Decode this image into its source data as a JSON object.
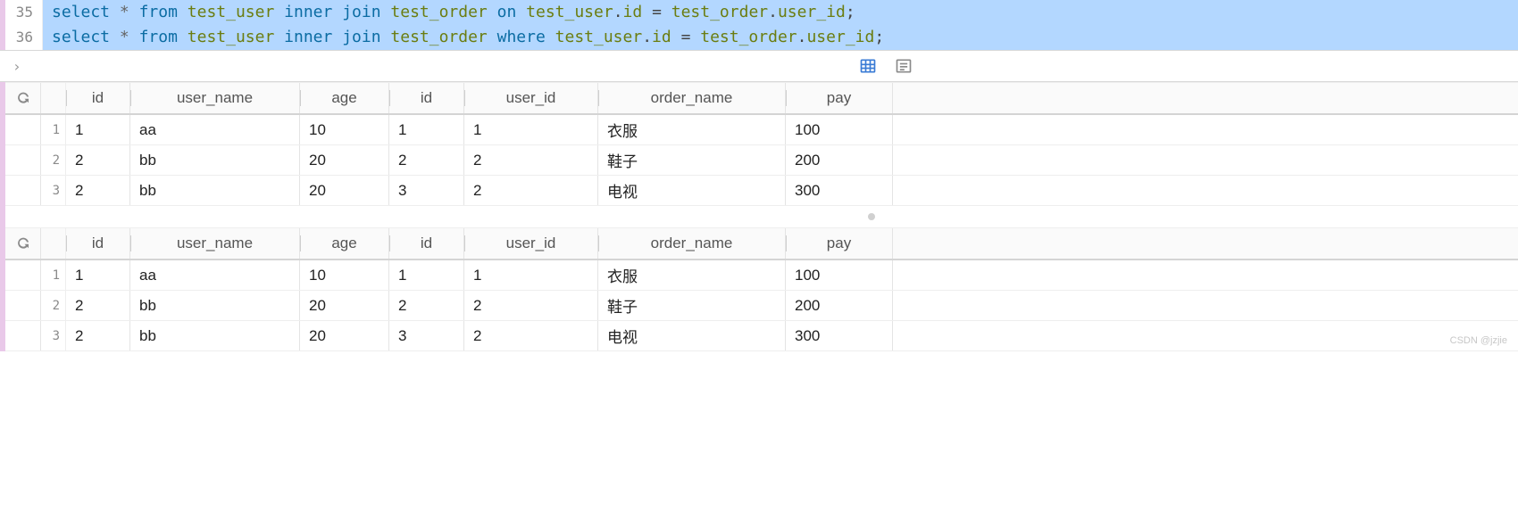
{
  "editor": {
    "lines": [
      {
        "num": "35",
        "selected": true,
        "tokens": [
          {
            "cls": "kw",
            "t": "select"
          },
          {
            "cls": "",
            "t": " "
          },
          {
            "cls": "star",
            "t": "*"
          },
          {
            "cls": "",
            "t": " "
          },
          {
            "cls": "kw",
            "t": "from"
          },
          {
            "cls": "",
            "t": " "
          },
          {
            "cls": "ident",
            "t": "test_user"
          },
          {
            "cls": "",
            "t": " "
          },
          {
            "cls": "kw",
            "t": "inner"
          },
          {
            "cls": "",
            "t": " "
          },
          {
            "cls": "kw",
            "t": "join"
          },
          {
            "cls": "",
            "t": " "
          },
          {
            "cls": "ident",
            "t": "test_order"
          },
          {
            "cls": "",
            "t": " "
          },
          {
            "cls": "kw",
            "t": "on"
          },
          {
            "cls": "",
            "t": " "
          },
          {
            "cls": "ident",
            "t": "test_user"
          },
          {
            "cls": "dot",
            "t": "."
          },
          {
            "cls": "ident",
            "t": "id"
          },
          {
            "cls": "",
            "t": " "
          },
          {
            "cls": "op",
            "t": "="
          },
          {
            "cls": "",
            "t": " "
          },
          {
            "cls": "ident",
            "t": "test_order"
          },
          {
            "cls": "dot",
            "t": "."
          },
          {
            "cls": "ident",
            "t": "user_id"
          },
          {
            "cls": "punct",
            "t": ";"
          }
        ]
      },
      {
        "num": "36",
        "selected": true,
        "tokens": [
          {
            "cls": "kw",
            "t": "select"
          },
          {
            "cls": "",
            "t": " "
          },
          {
            "cls": "star",
            "t": "*"
          },
          {
            "cls": "",
            "t": " "
          },
          {
            "cls": "kw",
            "t": "from"
          },
          {
            "cls": "",
            "t": " "
          },
          {
            "cls": "ident",
            "t": "test_user"
          },
          {
            "cls": "",
            "t": " "
          },
          {
            "cls": "kw",
            "t": "inner"
          },
          {
            "cls": "",
            "t": " "
          },
          {
            "cls": "kw",
            "t": "join"
          },
          {
            "cls": "",
            "t": " "
          },
          {
            "cls": "ident",
            "t": "test_order"
          },
          {
            "cls": "",
            "t": " "
          },
          {
            "cls": "kw",
            "t": "where"
          },
          {
            "cls": "",
            "t": " "
          },
          {
            "cls": "ident",
            "t": "test_user"
          },
          {
            "cls": "dot",
            "t": "."
          },
          {
            "cls": "ident",
            "t": "id"
          },
          {
            "cls": "",
            "t": " "
          },
          {
            "cls": "op",
            "t": "="
          },
          {
            "cls": "",
            "t": " "
          },
          {
            "cls": "ident",
            "t": "test_order"
          },
          {
            "cls": "dot",
            "t": "."
          },
          {
            "cls": "ident",
            "t": "user_id"
          },
          {
            "cls": "punct",
            "t": ";"
          }
        ]
      }
    ]
  },
  "columns": [
    {
      "key": "id",
      "label": "id",
      "cls": "c-id"
    },
    {
      "key": "user_name",
      "label": "user_name",
      "cls": "c-uname"
    },
    {
      "key": "age",
      "label": "age",
      "cls": "c-age"
    },
    {
      "key": "id2",
      "label": "id",
      "cls": "c-id2"
    },
    {
      "key": "user_id",
      "label": "user_id",
      "cls": "c-uid"
    },
    {
      "key": "order_name",
      "label": "order_name",
      "cls": "c-oname"
    },
    {
      "key": "pay",
      "label": "pay",
      "cls": "c-pay"
    }
  ],
  "result_sets": [
    {
      "rows": [
        {
          "id": "1",
          "user_name": "aa",
          "age": "10",
          "id2": "1",
          "user_id": "1",
          "order_name": "衣服",
          "pay": "100"
        },
        {
          "id": "2",
          "user_name": "bb",
          "age": "20",
          "id2": "2",
          "user_id": "2",
          "order_name": "鞋子",
          "pay": "200"
        },
        {
          "id": "2",
          "user_name": "bb",
          "age": "20",
          "id2": "3",
          "user_id": "2",
          "order_name": "电视",
          "pay": "300"
        }
      ]
    },
    {
      "rows": [
        {
          "id": "1",
          "user_name": "aa",
          "age": "10",
          "id2": "1",
          "user_id": "1",
          "order_name": "衣服",
          "pay": "100"
        },
        {
          "id": "2",
          "user_name": "bb",
          "age": "20",
          "id2": "2",
          "user_id": "2",
          "order_name": "鞋子",
          "pay": "200"
        },
        {
          "id": "2",
          "user_name": "bb",
          "age": "20",
          "id2": "3",
          "user_id": "2",
          "order_name": "电视",
          "pay": "300"
        }
      ]
    }
  ],
  "watermark": "CSDN @jzjie"
}
